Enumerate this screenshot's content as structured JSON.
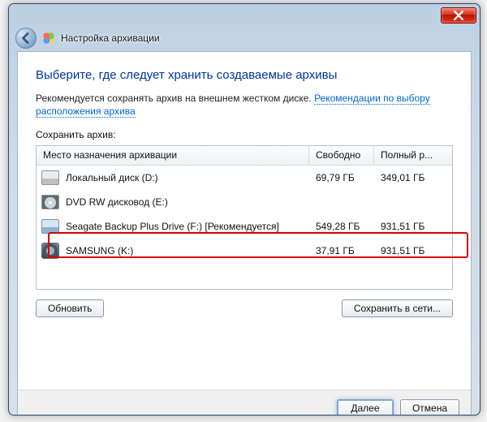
{
  "window": {
    "nav_title": "Настройка архивации"
  },
  "page": {
    "heading": "Выберите, где следует хранить создаваемые архивы",
    "reco_text": "Рекомендуется сохранять архив на внешнем жестком диске.",
    "reco_link": "Рекомендации по выбору расположения архива",
    "save_label": "Сохранить архив:"
  },
  "columns": {
    "name": "Место назначения архивации",
    "free": "Свободно",
    "full": "Полный р..."
  },
  "drives": [
    {
      "icon": "hdd",
      "name": "Локальный диск (D:)",
      "free": "69,79 ГБ",
      "full": "349,01 ГБ"
    },
    {
      "icon": "dvd",
      "name": "DVD RW дисковод (E:)",
      "free": "",
      "full": ""
    },
    {
      "icon": "ext",
      "name": "Seagate Backup Plus Drive (F:) [Рекомендуется]",
      "free": "549,28 ГБ",
      "full": "931,51 ГБ"
    },
    {
      "icon": "drive",
      "name": "SAMSUNG (K:)",
      "free": "37,91 ГБ",
      "full": "931,51 ГБ"
    }
  ],
  "buttons": {
    "refresh": "Обновить",
    "save_network": "Сохранить в сети...",
    "next": "Далее",
    "cancel": "Отмена"
  }
}
